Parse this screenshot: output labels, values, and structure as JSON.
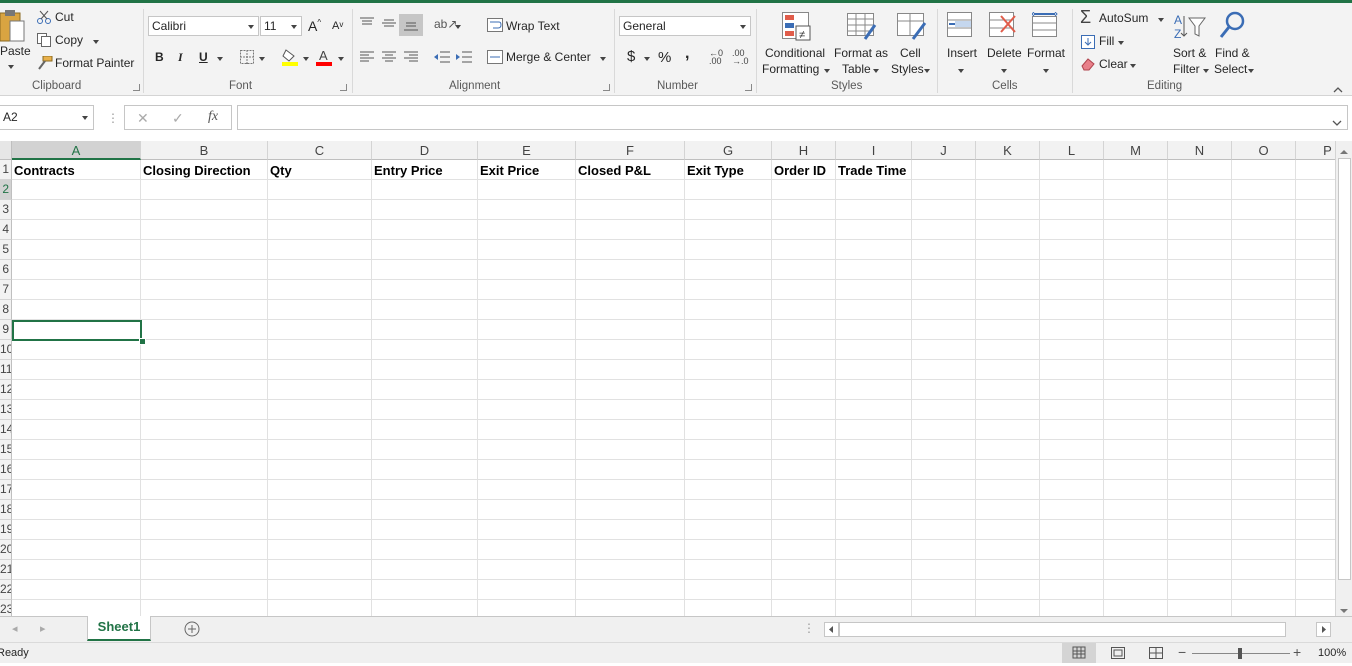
{
  "clipboard": {
    "paste_label": "Paste",
    "cut_label": "Cut",
    "copy_label": "Copy",
    "format_painter_label": "Format Painter",
    "group_label": "Clipboard"
  },
  "font": {
    "name": "Calibri",
    "size": "11",
    "bold": "B",
    "italic": "I",
    "underline": "U",
    "group_label": "Font"
  },
  "alignment": {
    "wrap_text_label": "Wrap Text",
    "merge_center_label": "Merge & Center",
    "group_label": "Alignment"
  },
  "number": {
    "format": "General",
    "currency_symbol": "$",
    "percent_symbol": "%",
    "comma_symbol": ",",
    "group_label": "Number"
  },
  "styles": {
    "conditional_formatting_line1": "Conditional",
    "conditional_formatting_line2": "Formatting",
    "format_as_table_line1": "Format as",
    "format_as_table_line2": "Table",
    "cell_styles_line1": "Cell",
    "cell_styles_line2": "Styles",
    "group_label": "Styles"
  },
  "cells": {
    "insert_label": "Insert",
    "delete_label": "Delete",
    "format_label": "Format",
    "group_label": "Cells"
  },
  "editing": {
    "autosum_label": "AutoSum",
    "fill_label": "Fill",
    "clear_label": "Clear",
    "sort_filter_line1": "Sort &",
    "sort_filter_line2": "Filter",
    "find_select_line1": "Find &",
    "find_select_line2": "Select",
    "group_label": "Editing"
  },
  "formula_bar": {
    "name_box": "A2",
    "fx_symbol": "fx",
    "content": ""
  },
  "sheet": {
    "columns": [
      "A",
      "B",
      "C",
      "D",
      "E",
      "F",
      "G",
      "H",
      "I",
      "J",
      "K",
      "L",
      "M",
      "N",
      "O",
      "P"
    ],
    "row_numbers": [
      "1",
      "2",
      "3",
      "4",
      "5",
      "6",
      "7",
      "8",
      "9",
      "10",
      "11",
      "12",
      "13",
      "14",
      "15",
      "16",
      "17",
      "18",
      "19",
      "20",
      "21",
      "22",
      "23"
    ],
    "headers": [
      "Contracts",
      "Closing Direction",
      "Qty",
      "Entry Price",
      "Exit Price",
      "Closed P&L",
      "Exit Type",
      "Order ID",
      "Trade Time"
    ],
    "selected_cell": "A2"
  },
  "tabs": {
    "active_sheet": "Sheet1"
  },
  "status": {
    "text": "Ready",
    "zoom": "100%"
  },
  "colors": {
    "accent": "#217346",
    "fill_color_bar": "#ffff00",
    "font_color_bar": "#ff0000"
  }
}
